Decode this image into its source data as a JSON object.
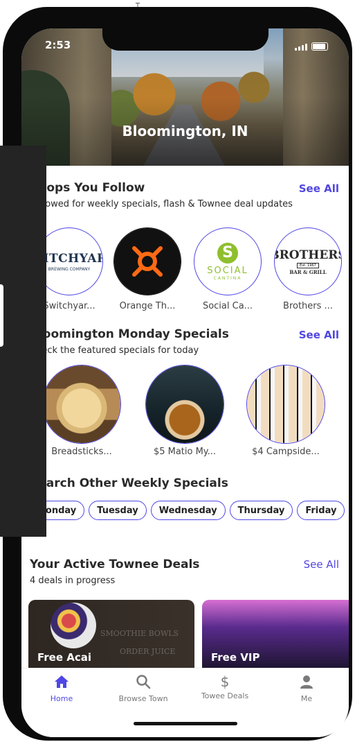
{
  "status_bar": {
    "time": "2:53"
  },
  "header": {
    "city": "Bloomington, IN"
  },
  "shops": {
    "title": "Shops You Follow",
    "subtitle": "Followed for weekly specials, flash & Townee deal updates",
    "see_all": "See All",
    "items": [
      {
        "label": "Switchyar...",
        "logo": "SWITCHYARD",
        "logo_sub": "BREWING COMPANY"
      },
      {
        "label": "Orange Th...",
        "logo": "orange-theory-icon"
      },
      {
        "label": "Social Ca...",
        "logo": "SOCIAL",
        "logo_sub": "CANTINA"
      },
      {
        "label": "Brothers ...",
        "logo": "BROTHERS",
        "logo_mid": "Est. 1967",
        "logo_sub": "BAR & GRILL"
      }
    ]
  },
  "monday": {
    "title": "Bloomington Monday Specials",
    "subtitle": "Check the featured specials for today",
    "see_all": "See All",
    "items": [
      {
        "label": "Breadsticks..."
      },
      {
        "label": "$5 Matio My..."
      },
      {
        "label": "$4 Campside..."
      }
    ]
  },
  "weekly": {
    "title": "Search Other Weekly Specials",
    "days": [
      "Monday",
      "Tuesday",
      "Wednesday",
      "Thursday",
      "Friday"
    ]
  },
  "deals": {
    "title": "Your Active Townee Deals",
    "subtitle": "4 deals in progress",
    "see_all": "See All",
    "cards": [
      {
        "label": "Free Acai",
        "sign_1": "SMOOTHIE BOWLS",
        "sign_2": "ORDER JUICE"
      },
      {
        "label": "Free VIP"
      }
    ]
  },
  "tabbar": {
    "items": [
      {
        "label": "Home",
        "icon": "home-icon",
        "active": true
      },
      {
        "label": "Browse Town",
        "icon": "search-icon"
      },
      {
        "label": "Towee Deals",
        "icon": "dollar-icon"
      },
      {
        "label": "Me",
        "icon": "person-icon"
      }
    ]
  },
  "colors": {
    "accent": "#4f46e5",
    "see_all": "#5146e0",
    "frame": "#0b0b0b",
    "overlay": "#242424"
  }
}
